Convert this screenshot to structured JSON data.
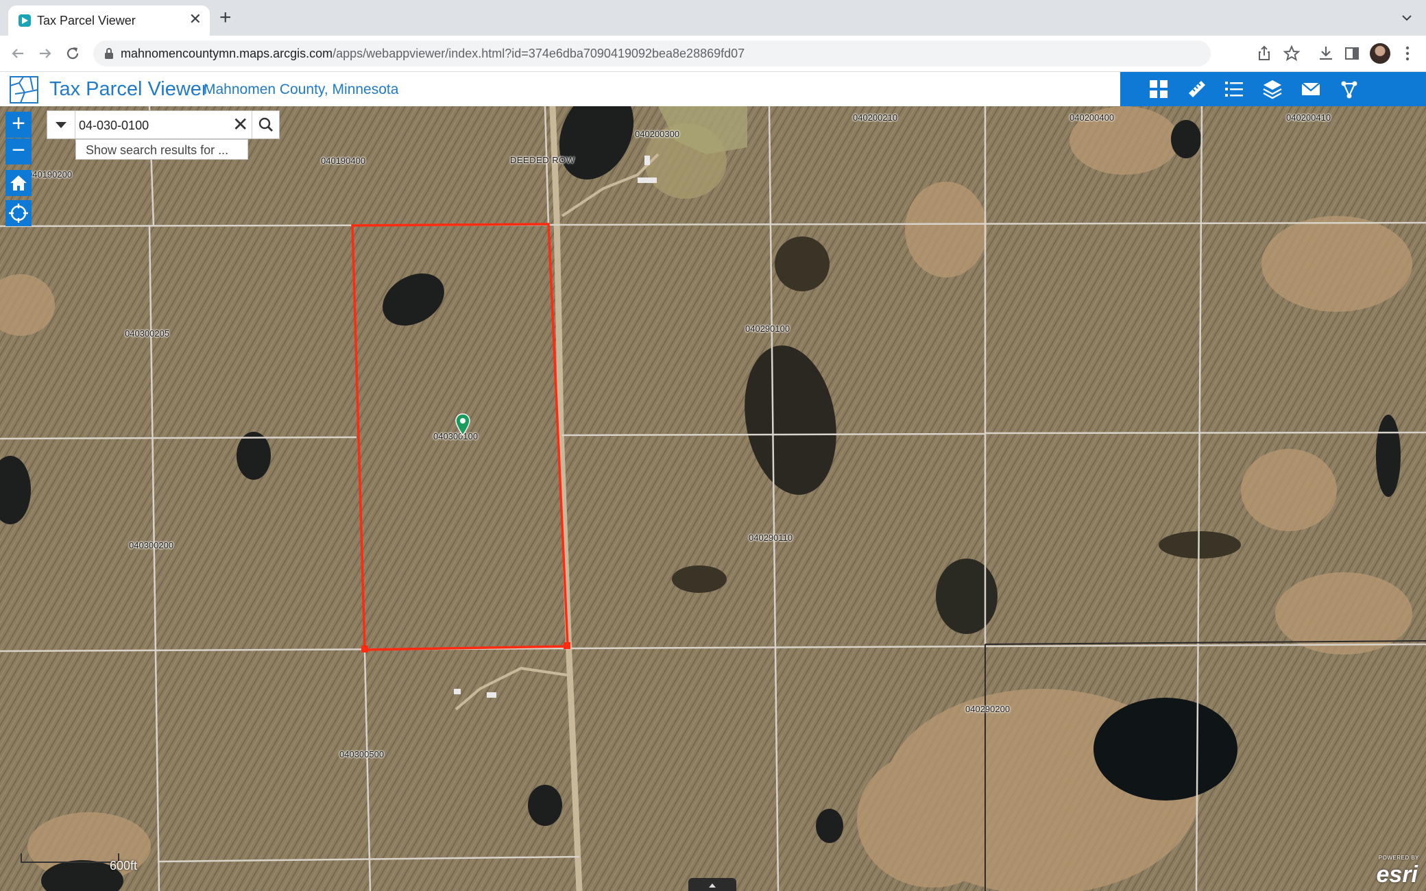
{
  "browser": {
    "tab_title": "Tax Parcel Viewer",
    "tab_close_symbol": "✕",
    "new_tab_symbol": "+",
    "url_host": "mahnomencountymn.maps.arcgis.com",
    "url_path": "/apps/webappviewer/index.html?id=374e6dba7090419092bea8e28869fd07"
  },
  "app": {
    "title": "Tax Parcel Viewer",
    "subtitle": "Mahnomen County, Minnesota",
    "accent": "#0f7ad6",
    "widgets": [
      "grid-icon",
      "measure-icon",
      "list-icon",
      "layers-icon",
      "mail-icon",
      "share-icon"
    ]
  },
  "map": {
    "zoom_in": "+",
    "zoom_out": "−",
    "search": {
      "value": "04-030-0100",
      "clear_symbol": "✕",
      "suggestion": "Show search results for ..."
    },
    "road_label": "DEEDED ROW",
    "parcel_labels": {
      "p040190200": "040190200",
      "p040190400": "040190400",
      "p040200300": "040200300",
      "p040200210": "040200210",
      "p040200400": "040200400",
      "p040200410": "040200410",
      "p040300205": "040300205",
      "p040290100": "040290100",
      "p040300100": "040300100",
      "p040300200": "040300200",
      "p040290110": "040290110",
      "p040300500": "040300500",
      "p040290200": "040290200"
    },
    "scale_label": "600ft",
    "esri_powered": "POWERED BY",
    "esri_name": "esri",
    "selected_parcel_color": "#ff2a10"
  }
}
